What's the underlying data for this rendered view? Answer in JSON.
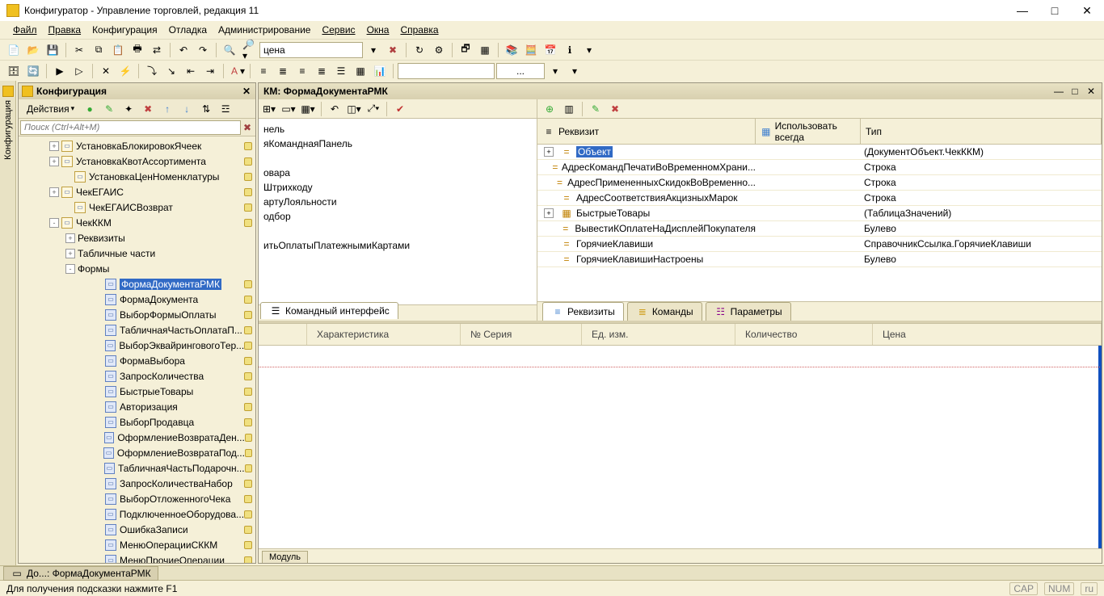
{
  "titlebar": {
    "text": "Конфигуратор - Управление торговлей, редакция 11"
  },
  "menu": [
    "Файл",
    "Правка",
    "Конфигурация",
    "Отладка",
    "Администрирование",
    "Сервис",
    "Окна",
    "Справка"
  ],
  "toolbar1": {
    "search_value": "цена"
  },
  "toolbar2": {
    "dots": "..."
  },
  "config_panel": {
    "title": "Конфигурация",
    "actions_label": "Действия",
    "search_placeholder": "Поиск (Ctrl+Alt+M)",
    "tree": [
      {
        "indent": 38,
        "toggle": "+",
        "icon": "doc",
        "label": "УстановкаБлокировокЯчеек",
        "trail": true
      },
      {
        "indent": 38,
        "toggle": "+",
        "icon": "doc",
        "label": "УстановкаКвотАссортимента",
        "trail": true
      },
      {
        "indent": 54,
        "toggle": "",
        "icon": "doc",
        "label": "УстановкаЦенНоменклатуры",
        "trail": true
      },
      {
        "indent": 38,
        "toggle": "+",
        "icon": "doc",
        "label": "ЧекЕГАИС",
        "trail": true
      },
      {
        "indent": 54,
        "toggle": "",
        "icon": "doc",
        "label": "ЧекЕГАИСВозврат",
        "trail": true
      },
      {
        "indent": 38,
        "toggle": "-",
        "icon": "doc",
        "label": "ЧекККМ",
        "trail": true
      },
      {
        "indent": 58,
        "toggle": "+",
        "icon": "",
        "label": "Реквизиты",
        "trail": false
      },
      {
        "indent": 58,
        "toggle": "+",
        "icon": "",
        "label": "Табличные части",
        "trail": false
      },
      {
        "indent": 58,
        "toggle": "-",
        "icon": "",
        "label": "Формы",
        "trail": false
      },
      {
        "indent": 92,
        "toggle": "",
        "icon": "form",
        "label": "ФормаДокументаРМК",
        "trail": true,
        "selected": true
      },
      {
        "indent": 92,
        "toggle": "",
        "icon": "form",
        "label": "ФормаДокумента",
        "trail": true
      },
      {
        "indent": 92,
        "toggle": "",
        "icon": "form",
        "label": "ВыборФормыОплаты",
        "trail": true
      },
      {
        "indent": 92,
        "toggle": "",
        "icon": "form",
        "label": "ТабличнаяЧастьОплатаП...",
        "trail": true
      },
      {
        "indent": 92,
        "toggle": "",
        "icon": "form",
        "label": "ВыборЭквайринговогоТер...",
        "trail": true
      },
      {
        "indent": 92,
        "toggle": "",
        "icon": "form",
        "label": "ФормаВыбора",
        "trail": true
      },
      {
        "indent": 92,
        "toggle": "",
        "icon": "form",
        "label": "ЗапросКоличества",
        "trail": true
      },
      {
        "indent": 92,
        "toggle": "",
        "icon": "form",
        "label": "БыстрыеТовары",
        "trail": true
      },
      {
        "indent": 92,
        "toggle": "",
        "icon": "form",
        "label": "Авторизация",
        "trail": true
      },
      {
        "indent": 92,
        "toggle": "",
        "icon": "form",
        "label": "ВыборПродавца",
        "trail": true
      },
      {
        "indent": 92,
        "toggle": "",
        "icon": "form",
        "label": "ОформлениеВозвратаДен...",
        "trail": true
      },
      {
        "indent": 92,
        "toggle": "",
        "icon": "form",
        "label": "ОформлениеВозвратаПод...",
        "trail": true
      },
      {
        "indent": 92,
        "toggle": "",
        "icon": "form",
        "label": "ТабличнаяЧастьПодарочн...",
        "trail": true
      },
      {
        "indent": 92,
        "toggle": "",
        "icon": "form",
        "label": "ЗапросКоличестваНабор",
        "trail": true
      },
      {
        "indent": 92,
        "toggle": "",
        "icon": "form",
        "label": "ВыборОтложенногоЧека",
        "trail": true
      },
      {
        "indent": 92,
        "toggle": "",
        "icon": "form",
        "label": "ПодключенноеОборудова...",
        "trail": true
      },
      {
        "indent": 92,
        "toggle": "",
        "icon": "form",
        "label": "ОшибкаЗаписи",
        "trail": true
      },
      {
        "indent": 92,
        "toggle": "",
        "icon": "form",
        "label": "МенюОперацииСККМ",
        "trail": true
      },
      {
        "indent": 92,
        "toggle": "",
        "icon": "form",
        "label": "МенюПрочиеОперации",
        "trail": true
      }
    ]
  },
  "left_tab": {
    "label": "Конфигурация"
  },
  "editor": {
    "title": "КМ: ФормаДокументаРМК",
    "left_lines": [
      "нель",
      "яКоманднаяПанель",
      "",
      "овара",
      "Штрихкоду",
      "артуЛояльности",
      "одбор",
      "",
      "итьОплатыПлатежнымиКартами"
    ],
    "ci_tab": "Командный интерфейс",
    "attrs_hdr": {
      "c1": "Реквизит",
      "c2": "Использовать всегда",
      "c3": "Тип"
    },
    "attrs": [
      {
        "toggle": "+",
        "icon": "=",
        "label": "Объект",
        "type": "(ДокументОбъект.ЧекККМ)",
        "sel": true
      },
      {
        "toggle": "",
        "icon": "=",
        "label": "АдресКомандПечатиВоВременномХрани...",
        "type": "Строка"
      },
      {
        "toggle": "",
        "icon": "=",
        "label": "АдресПримененныхСкидокВоВременно...",
        "type": "Строка"
      },
      {
        "toggle": "",
        "icon": "=",
        "label": "АдресСоответствияАкцизныхМарок",
        "type": "Строка"
      },
      {
        "toggle": "+",
        "icon": "▦",
        "label": "БыстрыеТовары",
        "type": "(ТаблицаЗначений)"
      },
      {
        "toggle": "",
        "icon": "=",
        "label": "ВывестиКОплатеНаДисплейПокупателя",
        "type": "Булево"
      },
      {
        "toggle": "",
        "icon": "=",
        "label": "ГорячиеКлавиши",
        "type": "СправочникСсылка.ГорячиеКлавиши"
      },
      {
        "toggle": "",
        "icon": "=",
        "label": "ГорячиеКлавишиНастроены",
        "type": "Булево"
      }
    ],
    "tabs": {
      "a": "Реквизиты",
      "b": "Команды",
      "c": "Параметры"
    },
    "preview_cols": [
      "",
      "Характеристика",
      "№ Серия",
      "Ед. изм.",
      "Количество",
      "Цена"
    ],
    "bottom_tab": "Модуль"
  },
  "taskbar": {
    "item": "До...: ФормаДокументаРМК"
  },
  "status": {
    "hint": "Для получения подсказки нажмите F1",
    "cap": "CAP",
    "num": "NUM",
    "lang": "ru"
  }
}
